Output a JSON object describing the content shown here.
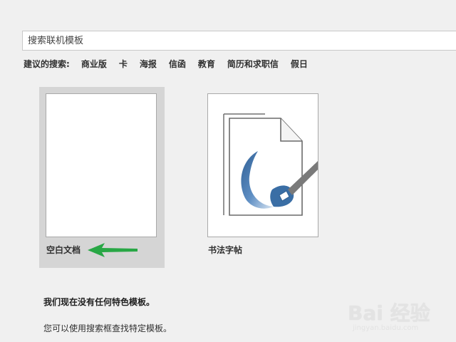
{
  "search": {
    "placeholder": "搜索联机模板",
    "value": ""
  },
  "suggested_searches": {
    "label": "建议的搜索:",
    "items": [
      "商业版",
      "卡",
      "海报",
      "信函",
      "教育",
      "简历和求职信",
      "假日"
    ]
  },
  "templates": [
    {
      "label": "空白文档",
      "icon": "blank-document-icon"
    },
    {
      "label": "书法字帖",
      "icon": "calligraphy-brush-icon"
    }
  ],
  "messages": {
    "no_featured": "我们现在没有任何特色模板。",
    "search_hint": "您可以使用搜索框查找特定模板。"
  },
  "annotation": {
    "arrow_color": "#28a745"
  },
  "watermark": {
    "text": "Bai 经验",
    "sub": "jingyan.baidu.com"
  },
  "colors": {
    "background": "#f0f0f0",
    "selected_tile": "#d5d5d5",
    "brush_blue": "#3a6ea5"
  }
}
